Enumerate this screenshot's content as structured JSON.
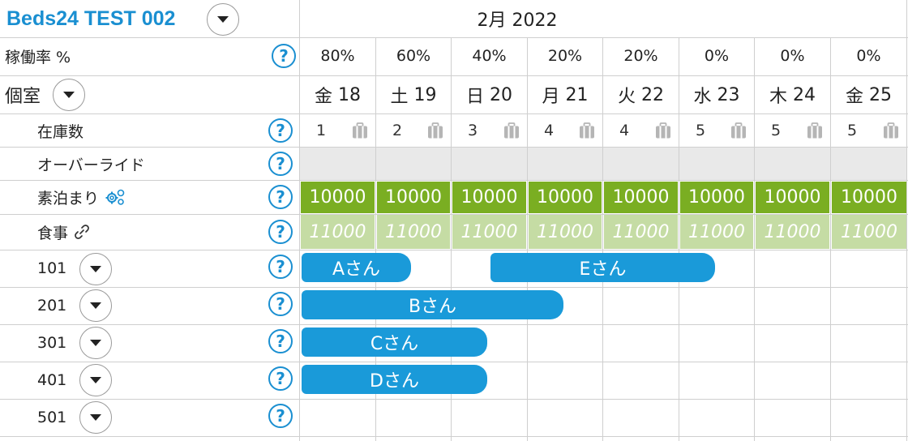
{
  "header": {
    "property_title": "Beds24 TEST 002",
    "month_label": "2月 2022"
  },
  "occupancy": {
    "label": "稼働率 %",
    "values": [
      "80%",
      "60%",
      "40%",
      "20%",
      "20%",
      "0%",
      "0%",
      "0%"
    ]
  },
  "room_type": {
    "label": "個室"
  },
  "days": [
    {
      "dow": "金",
      "date": "18"
    },
    {
      "dow": "土",
      "date": "19"
    },
    {
      "dow": "日",
      "date": "20"
    },
    {
      "dow": "月",
      "date": "21"
    },
    {
      "dow": "火",
      "date": "22"
    },
    {
      "dow": "水",
      "date": "23"
    },
    {
      "dow": "木",
      "date": "24"
    },
    {
      "dow": "金",
      "date": "25"
    }
  ],
  "inventory": {
    "label": "在庫数",
    "values": [
      "1",
      "2",
      "3",
      "4",
      "4",
      "5",
      "5",
      "5"
    ]
  },
  "override": {
    "label": "オーバーライド"
  },
  "room_only": {
    "label": "素泊まり",
    "prices": [
      "10000",
      "10000",
      "10000",
      "10000",
      "10000",
      "10000",
      "10000",
      "10000"
    ]
  },
  "meal": {
    "label": "食事",
    "prices": [
      "11000",
      "11000",
      "11000",
      "11000",
      "11000",
      "11000",
      "11000",
      "11000"
    ]
  },
  "help_symbol": "?",
  "rooms": [
    {
      "number": "101"
    },
    {
      "number": "201"
    },
    {
      "number": "301"
    },
    {
      "number": "401"
    },
    {
      "number": "501"
    }
  ],
  "bookings": [
    {
      "guest": "Aさん",
      "room": "101"
    },
    {
      "guest": "Eさん",
      "room": "101"
    },
    {
      "guest": "Bさん",
      "room": "201"
    },
    {
      "guest": "Cさん",
      "room": "301"
    },
    {
      "guest": "Dさん",
      "room": "401"
    }
  ],
  "colors": {
    "accent": "#1a8fd1",
    "booking": "#1a9ad9",
    "price_primary": "#7aae22",
    "price_secondary": "#c5dca4",
    "override_bg": "#e9e9e9"
  }
}
